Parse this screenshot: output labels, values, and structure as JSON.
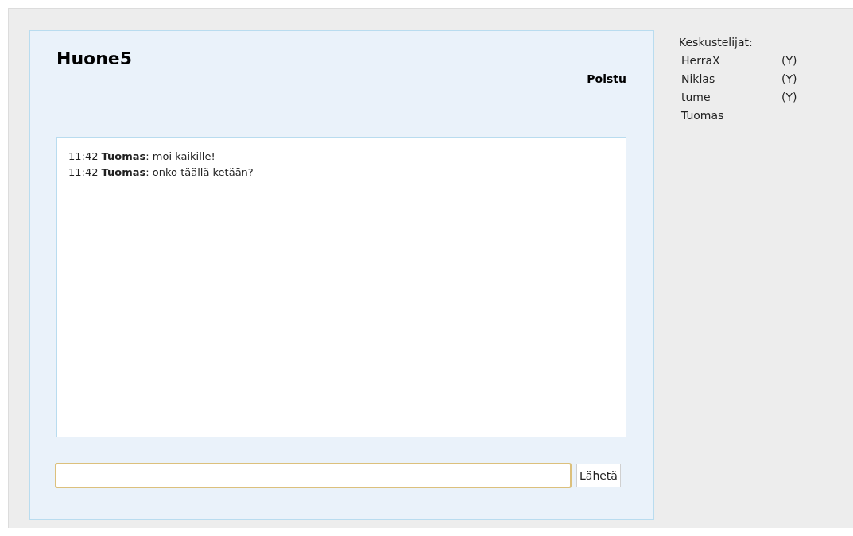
{
  "room": {
    "title": "Huone5",
    "leave_link": "Poistu"
  },
  "messages": [
    {
      "text": "11:42 **Tuomas**: moi kaikille!"
    },
    {
      "text": "11:42 **Tuomas**: onko täällä ketään?"
    }
  ],
  "composer": {
    "send_button": "Lähetä"
  },
  "participants": {
    "heading": "Keskustelijat:",
    "items": [
      {
        "name": "HerraX",
        "mark": "(Y)"
      },
      {
        "name": "Niklas",
        "mark": "(Y)"
      },
      {
        "name": "tume",
        "mark": "(Y)"
      },
      {
        "name": "Tuomas"
      }
    ]
  }
}
